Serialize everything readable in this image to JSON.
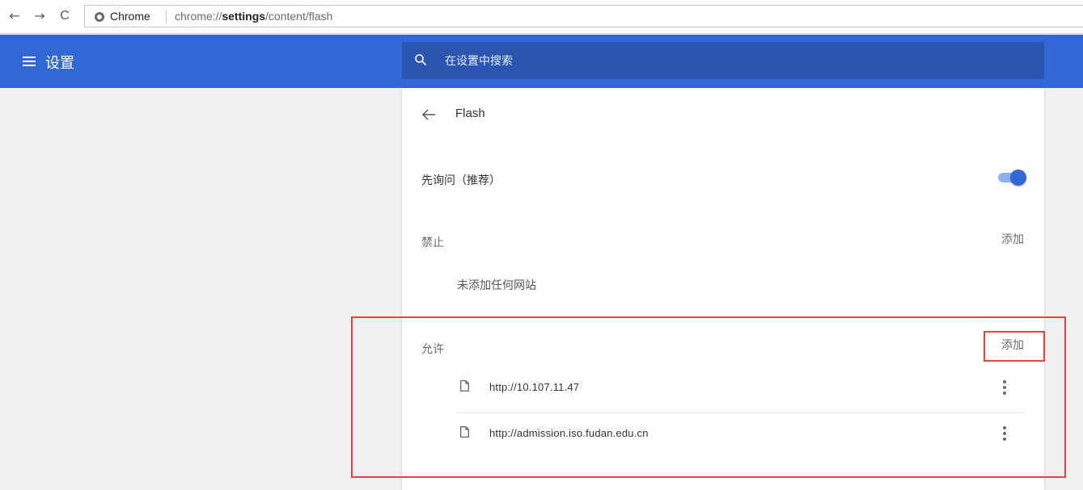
{
  "browser": {
    "back_glyph": "←",
    "forward_glyph": "→",
    "reload_glyph": "C",
    "site_name": "Chrome",
    "url_scheme": "chrome://",
    "url_host": "settings",
    "url_path": "/content/flash"
  },
  "header": {
    "title": "设置",
    "search_placeholder": "在设置中搜索",
    "accent_color": "#3367d6"
  },
  "page": {
    "title": "Flash",
    "ask_first": {
      "label": "先询问（推荐）",
      "enabled": true
    },
    "blocked": {
      "label": "禁止",
      "add_label": "添加",
      "empty_text": "未添加任何网站"
    },
    "allowed": {
      "label": "允许",
      "add_label": "添加",
      "sites": [
        {
          "url": "http://10.107.11.47"
        },
        {
          "url": "http://admission.iso.fudan.edu.cn"
        }
      ]
    }
  },
  "icons": [
    "menu-icon",
    "search-icon",
    "back-arrow-icon",
    "file-icon",
    "more-vert-icon",
    "chrome-icon"
  ],
  "annotation_color": "#e8443f"
}
